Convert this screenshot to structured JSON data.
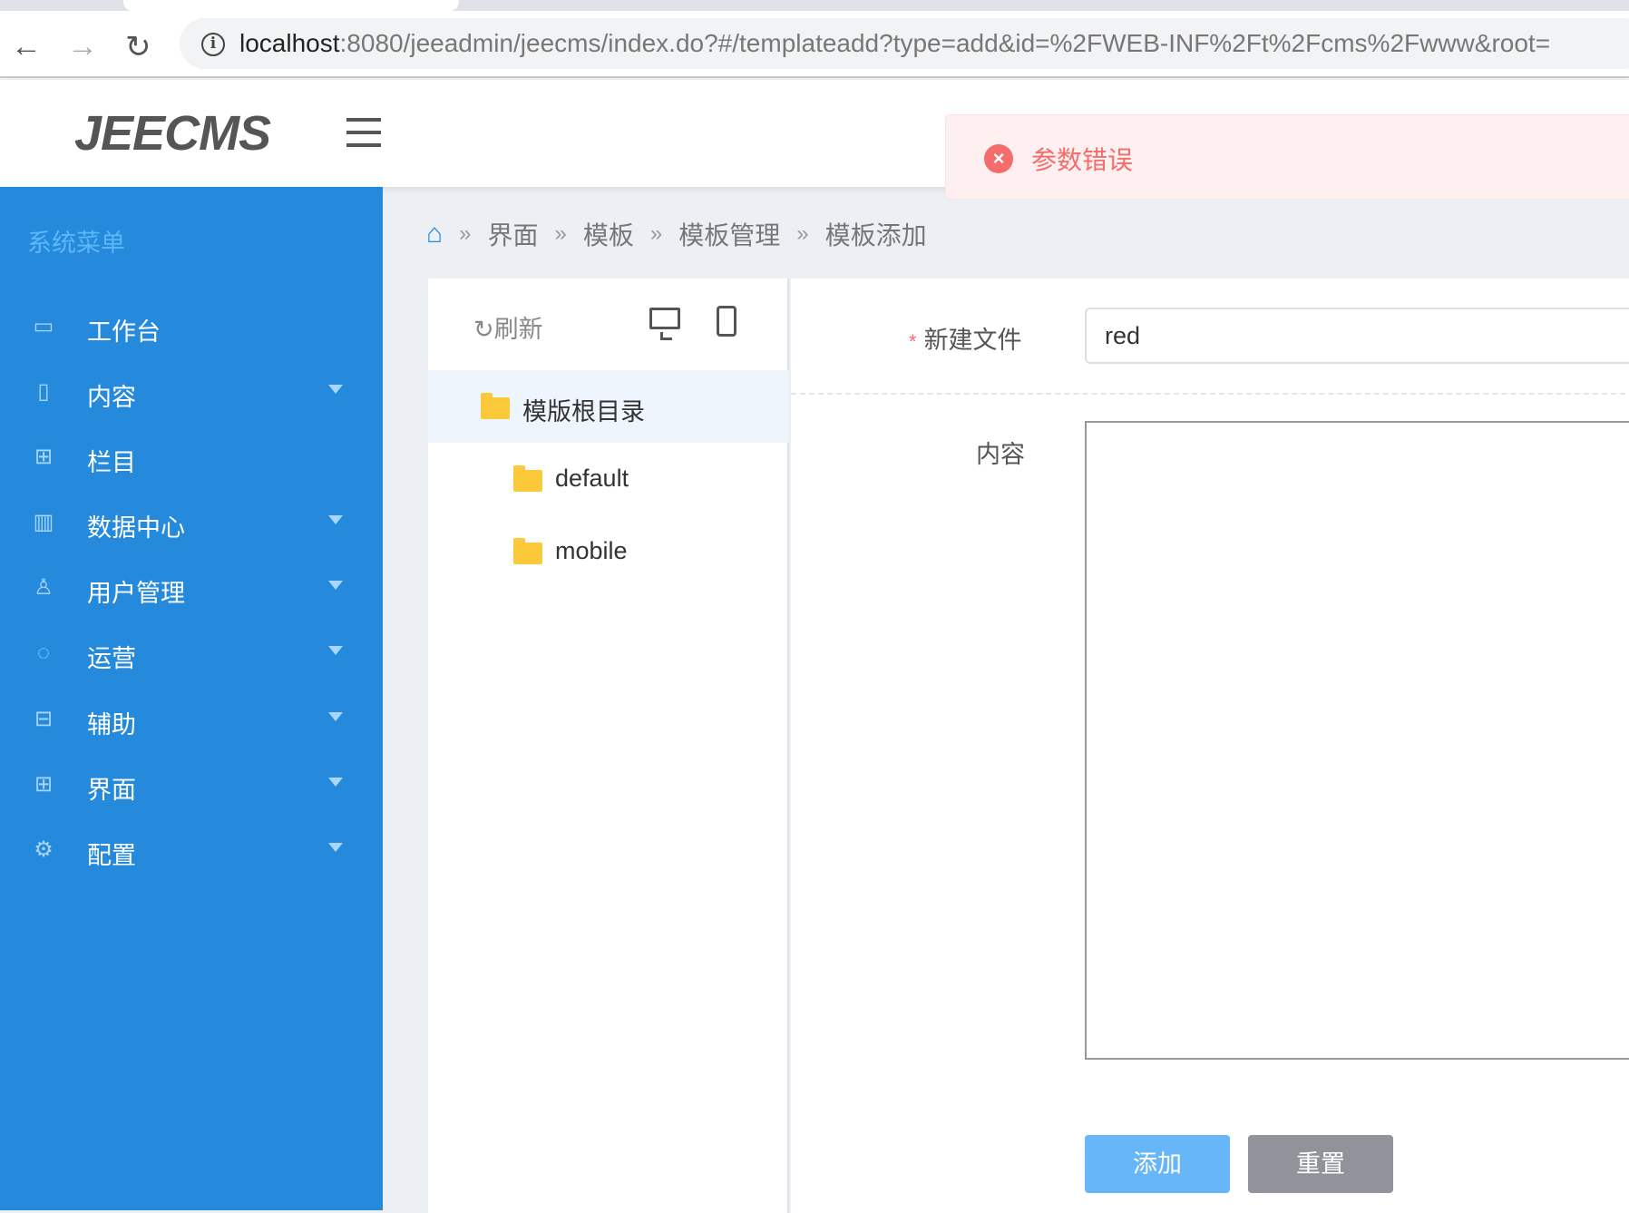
{
  "browser": {
    "url_host": "localhost",
    "url_rest": ":8080/jeeadmin/jeecms/index.do?#/templateadd?type=add&id=%2FWEB-INF%2Ft%2Fcms%2Fwww&root="
  },
  "header": {
    "logo": "JEECMS"
  },
  "toast": {
    "message": "参数错误"
  },
  "sidebar": {
    "title": "系统菜单",
    "items": [
      {
        "label": "工作台",
        "icon": "monitor-icon",
        "expandable": false
      },
      {
        "label": "内容",
        "icon": "document-icon",
        "expandable": true
      },
      {
        "label": "栏目",
        "icon": "grid-icon",
        "expandable": false
      },
      {
        "label": "数据中心",
        "icon": "bar-chart-icon",
        "expandable": true
      },
      {
        "label": "用户管理",
        "icon": "user-icon",
        "expandable": true
      },
      {
        "label": "运营",
        "icon": "cycle-icon",
        "expandable": true
      },
      {
        "label": "辅助",
        "icon": "toolbox-icon",
        "expandable": true
      },
      {
        "label": "界面",
        "icon": "layout-icon",
        "expandable": true
      },
      {
        "label": "配置",
        "icon": "gear-icon",
        "expandable": true
      }
    ]
  },
  "breadcrumb": [
    "界面",
    "模板",
    "模板管理",
    "模板添加"
  ],
  "tree": {
    "refresh": "刷新",
    "root": "模版根目录",
    "children": [
      "default",
      "mobile"
    ]
  },
  "form": {
    "filename_label": "新建文件",
    "filename_value": "red",
    "content_label": "内容",
    "submit": "添加",
    "reset": "重置"
  }
}
